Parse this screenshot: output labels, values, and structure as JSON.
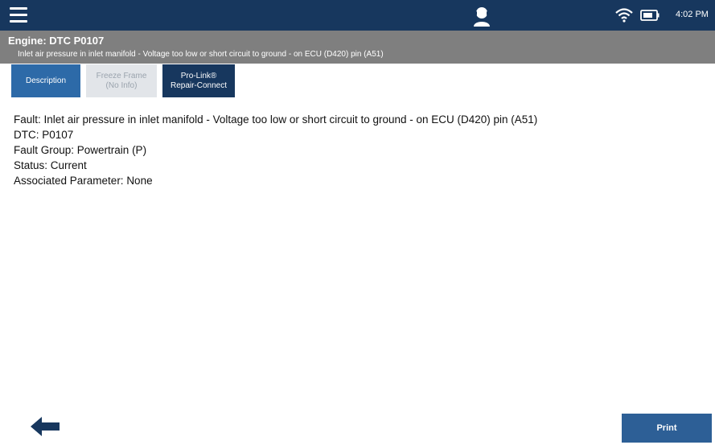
{
  "topbar": {
    "icons": {
      "menu": "hamburger-menu-icon",
      "support": "support-agent-icon",
      "wifi": "wifi-icon",
      "battery": "battery-icon"
    },
    "time": "4:02 PM"
  },
  "header": {
    "title": "Engine: DTC P0107",
    "subtitle": "Inlet air pressure in inlet manifold - Voltage too low or short circuit to ground - on ECU (D420) pin (A51)"
  },
  "tabs": [
    {
      "line1": "Description",
      "line2": ""
    },
    {
      "line1": "Freeze Frame",
      "line2": "(No Info)"
    },
    {
      "line1": "Pro-Link®",
      "line2": "Repair-Connect"
    }
  ],
  "details": {
    "fault": "Fault: Inlet air pressure in inlet manifold - Voltage too low or short circuit to ground - on ECU (D420) pin (A51)",
    "dtc": "DTC: P0107",
    "fault_group": "Fault Group: Powertrain (P)",
    "status": "Status: Current",
    "associated_parameter": "Associated Parameter: None"
  },
  "footer": {
    "back_icon": "arrow-left-icon",
    "print_label": "Print"
  },
  "colors": {
    "topbar": "#17375e",
    "header": "#7f7f7f",
    "tab_active": "#2d6aa8",
    "tab_disabled": "#e2e5e9",
    "tab_dark": "#17375e",
    "print_button": "#2d5f96"
  }
}
